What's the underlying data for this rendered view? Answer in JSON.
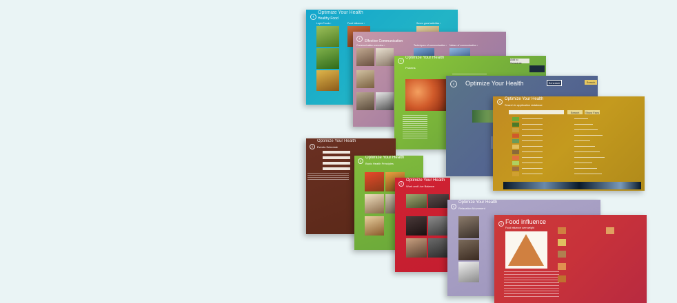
{
  "app_title": "Optimize Your Health",
  "screens": {
    "healthy_food": {
      "title": "Healthy Food",
      "groups": [
        "Lupin Foods ›",
        "Food influence ›",
        "Seven great activities ›"
      ],
      "tiles": [
        {
          "color": "#7a9a3a"
        },
        {
          "color": "#b08540"
        },
        {
          "color": "#4b8a2a"
        },
        {
          "color": "#c9a64a"
        },
        {
          "color": "#6a5a3a"
        },
        {
          "color": "#a0b05a"
        }
      ]
    },
    "communication": {
      "title": "Effective Communication",
      "groups": [
        "Communication overview ›",
        "Techniques of communication ›",
        "Nature of communication ›"
      ]
    },
    "proteins": {
      "title": "Proteins",
      "button": "Add to Schedule",
      "logo": "FLIGHT"
    },
    "schedule_screen": {
      "title": "Optimize Your Health",
      "buttons": [
        "Schedule",
        "Search"
      ]
    },
    "search": {
      "title": "Optimize Your Health",
      "subtitle": "Search in application database",
      "buttons": [
        "Search",
        "Show Favs"
      ],
      "rows": 11,
      "banner": "FLIGHT"
    },
    "events": {
      "title": "Optimize Your Health",
      "subtitle": "Events Schedule"
    },
    "basic_health": {
      "title": "Optimize Your Health",
      "subtitle": "Basic Health Principles"
    },
    "work_life": {
      "title": "Optimize Your Health",
      "subtitle": "Work and Live Balance"
    },
    "relaxation": {
      "title": "Optimize Your Health",
      "subtitle": "Relaxation Movement"
    },
    "food_influence": {
      "title": "Food influence",
      "subtitle": "Food influence over weight"
    }
  },
  "colors": {
    "background": "#eaf4f5",
    "teal": "#1ea8c8",
    "mauve": "#a87e9a",
    "green": "#7cb832",
    "slate": "#586a8c",
    "gold": "#c89a22",
    "brown": "#5a2a1e",
    "lime": "#7ab43a",
    "crimson": "#c81e32",
    "lavender": "#a49cc2",
    "red": "#c8323a"
  }
}
